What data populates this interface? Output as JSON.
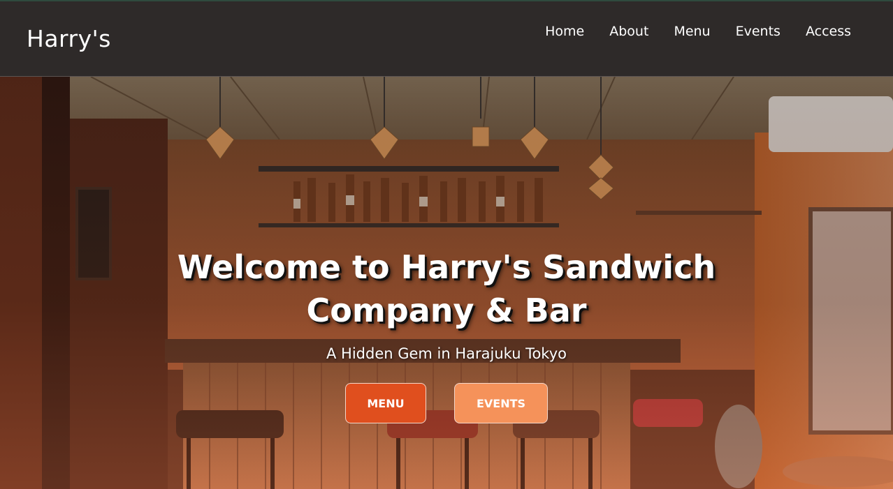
{
  "header": {
    "brand": "Harry's",
    "nav": [
      "Home",
      "About",
      "Menu",
      "Events",
      "Access"
    ]
  },
  "hero": {
    "title_line1": "Welcome to Harry's Sandwich",
    "title_line2": "Company & Bar",
    "subtitle": "A Hidden Gem in Harajuku Tokyo",
    "buttons": {
      "menu": "MENU",
      "events": "EVENTS"
    }
  },
  "colors": {
    "header_bg": "#2e2a29",
    "menu_button": "#e04f1e",
    "events_button": "#f5925a"
  }
}
